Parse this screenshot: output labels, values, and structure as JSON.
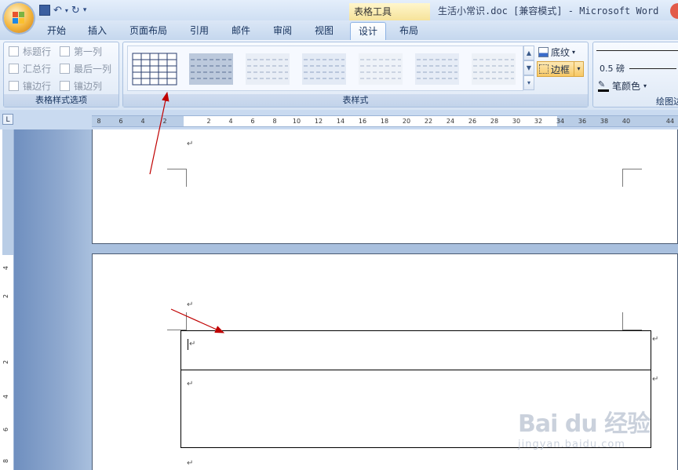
{
  "window": {
    "title": "生活小常识.doc [兼容模式] - Microsoft Word",
    "context_tab_header": "表格工具"
  },
  "tabs": [
    {
      "label": "开始",
      "active": false
    },
    {
      "label": "插入",
      "active": false
    },
    {
      "label": "页面布局",
      "active": false
    },
    {
      "label": "引用",
      "active": false
    },
    {
      "label": "邮件",
      "active": false
    },
    {
      "label": "审阅",
      "active": false
    },
    {
      "label": "视图",
      "active": false
    },
    {
      "label": "设计",
      "active": true
    },
    {
      "label": "布局",
      "active": false
    }
  ],
  "ribbon": {
    "style_options": {
      "label": "表格样式选项",
      "checkboxes": [
        "标题行",
        "第一列",
        "汇总行",
        "最后一列",
        "镶边行",
        "镶边列"
      ]
    },
    "table_styles": {
      "label": "表样式",
      "shading_label": "底纹",
      "borders_label": "边框"
    },
    "draw_borders": {
      "weight": "0.5 磅",
      "pen_color_label": "笔颜色",
      "label": "绘图边"
    }
  },
  "ruler": {
    "ticks": [
      "8",
      "6",
      "4",
      "2",
      "2",
      "4",
      "6",
      "8",
      "10",
      "12",
      "14",
      "16",
      "18",
      "20",
      "22",
      "24",
      "26",
      "28",
      "30",
      "32",
      "34",
      "36",
      "38",
      "40",
      "44"
    ],
    "vertical_ticks": [
      "4",
      "2",
      "2",
      "4",
      "6",
      "8"
    ]
  },
  "document": {
    "para_mark": "↵"
  },
  "watermark": {
    "brand": "Bai du 经验",
    "domain": "jingyan.baidu.com"
  },
  "colors": {
    "active_tab_border": "#8db2e3",
    "borders_button": "#f7c865",
    "annotation_arrow": "#c00000"
  }
}
